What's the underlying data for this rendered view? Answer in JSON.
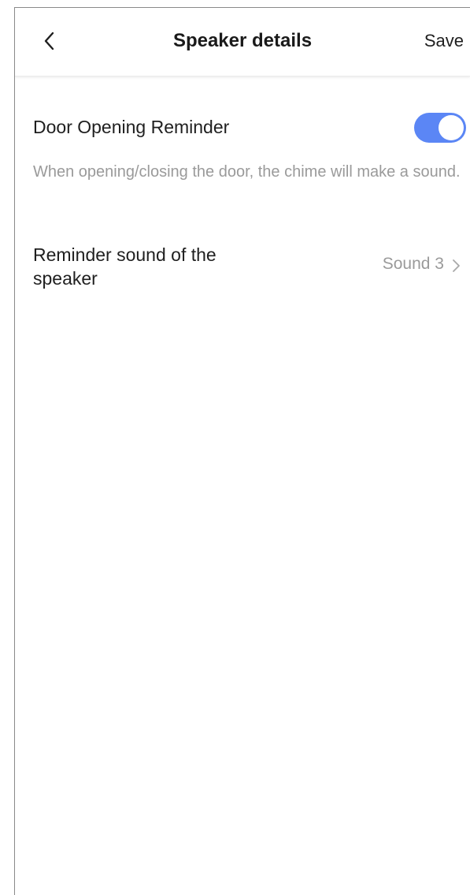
{
  "header": {
    "title": "Speaker details",
    "save_label": "Save",
    "back_icon": "chevron-left-icon"
  },
  "door_reminder": {
    "label": "Door Opening Reminder",
    "enabled": true,
    "toggle_color": "#5b86f5",
    "description": "When opening/closing the door, the chime will make a sound."
  },
  "reminder_sound": {
    "label": "Reminder sound of the speaker",
    "value": "Sound 3",
    "chevron_icon": "chevron-right-icon"
  }
}
